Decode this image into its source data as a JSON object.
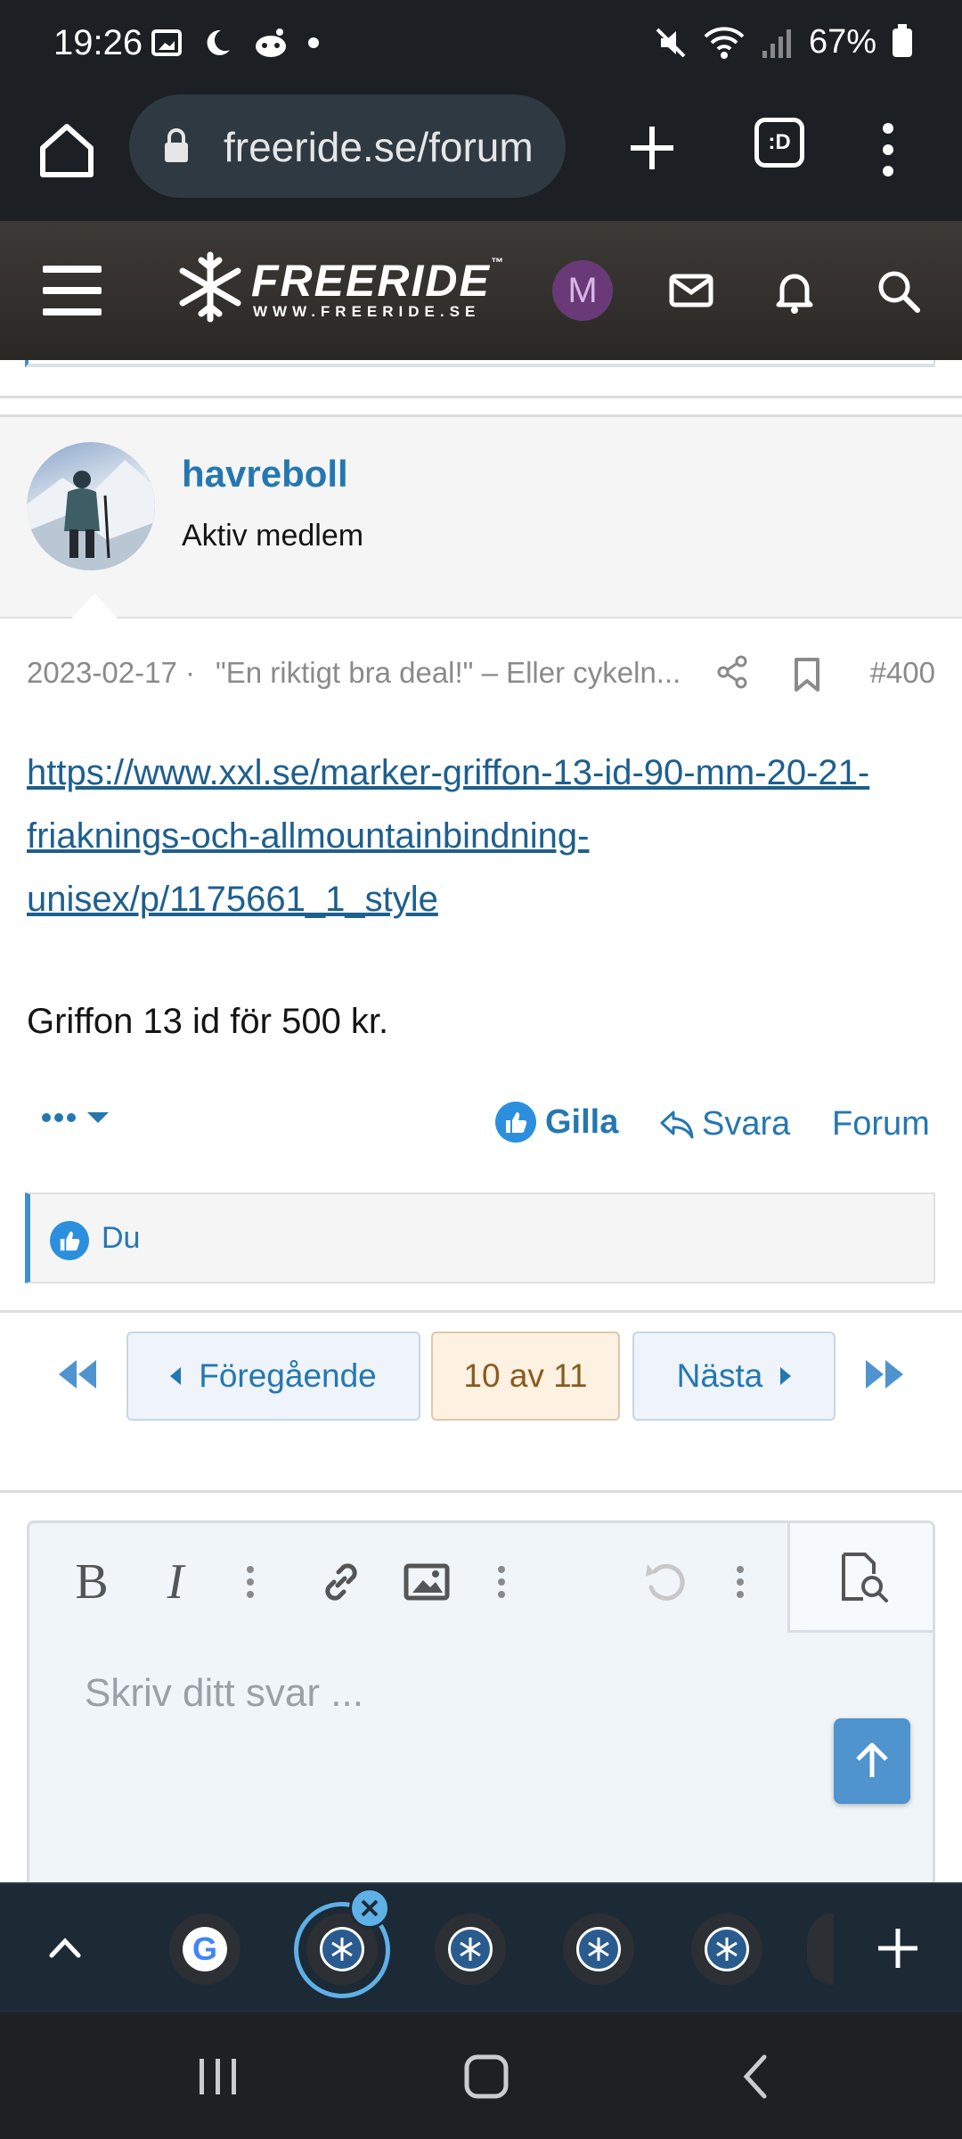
{
  "status_bar": {
    "time": "19:26",
    "battery": "67%",
    "icons": [
      "gallery-icon",
      "moon-icon",
      "reddit-icon",
      "dot-icon",
      "mute-icon",
      "wifi-icon",
      "signal-icon",
      "battery-icon"
    ]
  },
  "browser": {
    "url": "freeride.se/forum",
    "tabs_label": ":D"
  },
  "site_header": {
    "logo_text": "FREERIDE",
    "logo_tm": "™",
    "logo_sub": "WWW.FREERIDE.SE",
    "avatar_letter": "M",
    "accent": "#2577b1"
  },
  "post": {
    "username": "havreboll",
    "user_title": "Aktiv medlem",
    "date": "2023-02-17",
    "separator": "·",
    "thread_title": "\"En riktigt bra deal!\" – Eller cykeln...",
    "post_number": "#400",
    "link": "https://www.xxl.se/marker-griffon-13-id-90-mm-20-21-friaknings-och-allmountainbindning-unisex/p/1175661_1_style",
    "link_lines": [
      "https://www.xxl.se/marker-griffon-13-id-90-mm-20-21-",
      "friaknings-och-allmountainbindning-",
      "unisex/p/1175661_1_style"
    ],
    "body": "Griffon 13 id för 500 kr.",
    "actions": {
      "like": "Gilla",
      "reply": "Svara",
      "forum": "Forum"
    },
    "likes_text": "Du"
  },
  "pager": {
    "prev": "Föregående",
    "current": "10 av 11",
    "next": "Nästa"
  },
  "editor": {
    "placeholder": "Skriv ditt svar ..."
  }
}
